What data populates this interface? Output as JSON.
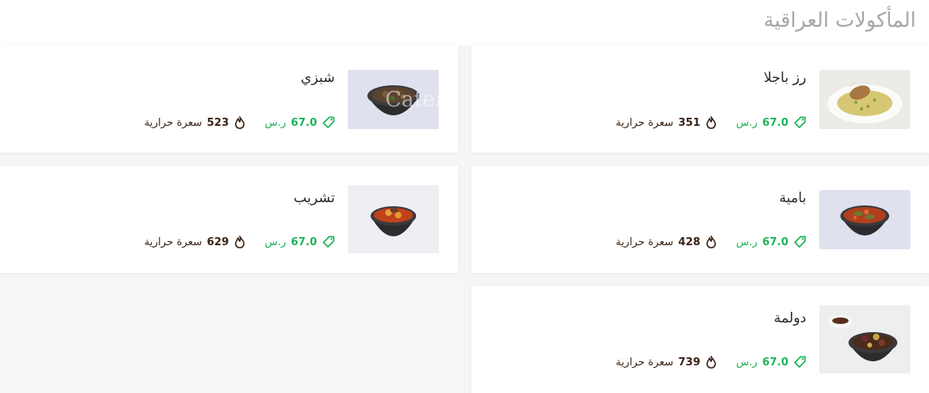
{
  "section": {
    "title": "المأكولات العراقية"
  },
  "currency": "ر.س",
  "calorie_label": "سعرة حرارية",
  "watermark": "Cater",
  "dishes": [
    {
      "name": "رز باجلا",
      "price": "67.0",
      "calories": "351"
    },
    {
      "name": "شبزي",
      "price": "67.0",
      "calories": "523"
    },
    {
      "name": "بامية",
      "price": "67.0",
      "calories": "428"
    },
    {
      "name": "تشريب",
      "price": "67.0",
      "calories": "629"
    },
    {
      "name": "دولمة",
      "price": "67.0",
      "calories": "739"
    }
  ]
}
